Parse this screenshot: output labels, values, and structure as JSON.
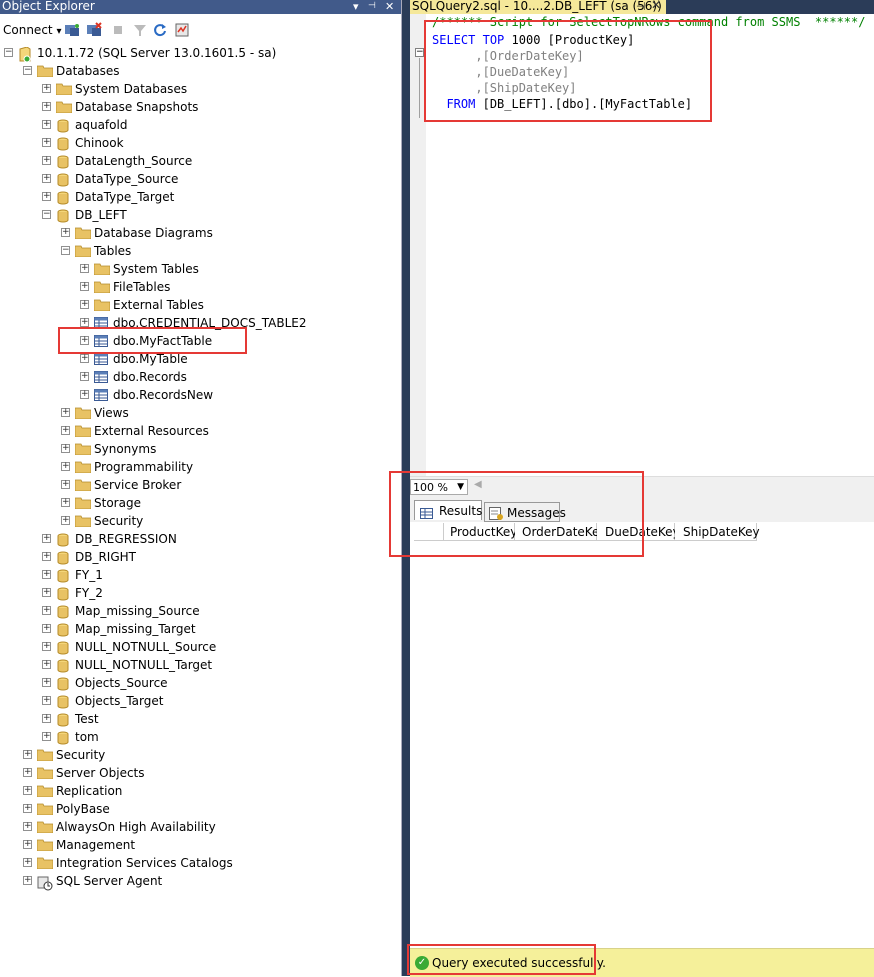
{
  "object_explorer": {
    "title": "Object Explorer",
    "title_controls": {
      "dropdown": "▾",
      "pin": "📌",
      "close": "✕"
    },
    "toolbar": {
      "connect_label": "Connect",
      "connect_arrow": "▾"
    },
    "tree": [
      {
        "label": "10.1.1.72 (SQL Server 13.0.1601.5 - sa)",
        "level": 0,
        "icon": "server-icon",
        "expander": "minus"
      },
      {
        "label": "Databases",
        "level": 1,
        "icon": "folder-icon",
        "expander": "minus"
      },
      {
        "label": "System Databases",
        "level": 2,
        "icon": "folder-icon",
        "expander": "plus"
      },
      {
        "label": "Database Snapshots",
        "level": 2,
        "icon": "folder-icon",
        "expander": "plus"
      },
      {
        "label": "aquafold",
        "level": 2,
        "icon": "database-icon",
        "expander": "plus"
      },
      {
        "label": "Chinook",
        "level": 2,
        "icon": "database-icon",
        "expander": "plus"
      },
      {
        "label": "DataLength_Source",
        "level": 2,
        "icon": "database-icon",
        "expander": "plus"
      },
      {
        "label": "DataType_Source",
        "level": 2,
        "icon": "database-icon",
        "expander": "plus"
      },
      {
        "label": "DataType_Target",
        "level": 2,
        "icon": "database-icon",
        "expander": "plus"
      },
      {
        "label": "DB_LEFT",
        "level": 2,
        "icon": "database-icon",
        "expander": "minus"
      },
      {
        "label": "Database Diagrams",
        "level": 3,
        "icon": "folder-icon",
        "expander": "plus"
      },
      {
        "label": "Tables",
        "level": 3,
        "icon": "folder-icon",
        "expander": "minus"
      },
      {
        "label": "System Tables",
        "level": 4,
        "icon": "folder-icon",
        "expander": "plus"
      },
      {
        "label": "FileTables",
        "level": 4,
        "icon": "folder-icon",
        "expander": "plus"
      },
      {
        "label": "External Tables",
        "level": 4,
        "icon": "folder-icon",
        "expander": "plus"
      },
      {
        "label": "dbo.CREDENTIAL_DOCS_TABLE2",
        "level": 4,
        "icon": "table-icon",
        "expander": "plus"
      },
      {
        "label": "dbo.MyFactTable",
        "level": 4,
        "icon": "table-icon",
        "expander": "plus",
        "selected": true
      },
      {
        "label": "dbo.MyTable",
        "level": 4,
        "icon": "table-icon",
        "expander": "plus"
      },
      {
        "label": "dbo.Records",
        "level": 4,
        "icon": "table-icon",
        "expander": "plus"
      },
      {
        "label": "dbo.RecordsNew",
        "level": 4,
        "icon": "table-icon",
        "expander": "plus"
      },
      {
        "label": "Views",
        "level": 3,
        "icon": "folder-icon",
        "expander": "plus"
      },
      {
        "label": "External Resources",
        "level": 3,
        "icon": "folder-icon",
        "expander": "plus"
      },
      {
        "label": "Synonyms",
        "level": 3,
        "icon": "folder-icon",
        "expander": "plus"
      },
      {
        "label": "Programmability",
        "level": 3,
        "icon": "folder-icon",
        "expander": "plus"
      },
      {
        "label": "Service Broker",
        "level": 3,
        "icon": "folder-icon",
        "expander": "plus"
      },
      {
        "label": "Storage",
        "level": 3,
        "icon": "folder-icon",
        "expander": "plus"
      },
      {
        "label": "Security",
        "level": 3,
        "icon": "folder-icon",
        "expander": "plus"
      },
      {
        "label": "DB_REGRESSION",
        "level": 2,
        "icon": "database-icon",
        "expander": "plus"
      },
      {
        "label": "DB_RIGHT",
        "level": 2,
        "icon": "database-icon",
        "expander": "plus"
      },
      {
        "label": "FY_1",
        "level": 2,
        "icon": "database-icon",
        "expander": "plus"
      },
      {
        "label": "FY_2",
        "level": 2,
        "icon": "database-icon",
        "expander": "plus"
      },
      {
        "label": "Map_missing_Source",
        "level": 2,
        "icon": "database-icon",
        "expander": "plus"
      },
      {
        "label": "Map_missing_Target",
        "level": 2,
        "icon": "database-icon",
        "expander": "plus"
      },
      {
        "label": "NULL_NOTNULL_Source",
        "level": 2,
        "icon": "database-icon",
        "expander": "plus"
      },
      {
        "label": "NULL_NOTNULL_Target",
        "level": 2,
        "icon": "database-icon",
        "expander": "plus"
      },
      {
        "label": "Objects_Source",
        "level": 2,
        "icon": "database-icon",
        "expander": "plus"
      },
      {
        "label": "Objects_Target",
        "level": 2,
        "icon": "database-icon",
        "expander": "plus"
      },
      {
        "label": "Test",
        "level": 2,
        "icon": "database-icon",
        "expander": "plus"
      },
      {
        "label": "tom",
        "level": 2,
        "icon": "database-icon",
        "expander": "plus"
      },
      {
        "label": "Security",
        "level": 1,
        "icon": "folder-icon",
        "expander": "plus"
      },
      {
        "label": "Server Objects",
        "level": 1,
        "icon": "folder-icon",
        "expander": "plus"
      },
      {
        "label": "Replication",
        "level": 1,
        "icon": "folder-icon",
        "expander": "plus"
      },
      {
        "label": "PolyBase",
        "level": 1,
        "icon": "folder-icon",
        "expander": "plus"
      },
      {
        "label": "AlwaysOn High Availability",
        "level": 1,
        "icon": "folder-icon",
        "expander": "plus"
      },
      {
        "label": "Management",
        "level": 1,
        "icon": "folder-icon",
        "expander": "plus"
      },
      {
        "label": "Integration Services Catalogs",
        "level": 1,
        "icon": "folder-icon",
        "expander": "plus"
      },
      {
        "label": "SQL Server Agent",
        "level": 1,
        "icon": "agent-icon",
        "expander": "plus"
      }
    ]
  },
  "editor": {
    "tab_title": "SQLQuery2.sql - 10....2.DB_LEFT (sa (56))",
    "tab_pin": "⊣",
    "tab_close": "✕",
    "code": {
      "comment": "/****** Script for SelectTopNRows command from SSMS  ******/",
      "line1_kw1": "SELECT",
      "line1_kw2": "TOP",
      "line1_rest": "1000 [ProductKey]",
      "line2": "      ,[OrderDateKey]",
      "line3": "      ,[DueDateKey]",
      "line4": "      ,[ShipDateKey]",
      "line5_kw": "FROM",
      "line5_rest": "[DB_LEFT].[dbo].[MyFactTable]"
    },
    "zoom": "100 %"
  },
  "results": {
    "tabs": [
      {
        "label": "Results",
        "icon": "grid-icon"
      },
      {
        "label": "Messages",
        "icon": "messages-icon"
      }
    ],
    "columns": [
      "ProductKey",
      "OrderDateKey",
      "DueDateKey",
      "ShipDateKey"
    ]
  },
  "status": {
    "text": "Query executed successfully.",
    "color": "#f5f09a"
  },
  "colors": {
    "highlight": "#e53935",
    "dark_chrome": "#2b3c58",
    "keyword": "#0000ff",
    "comment": "#008000"
  }
}
